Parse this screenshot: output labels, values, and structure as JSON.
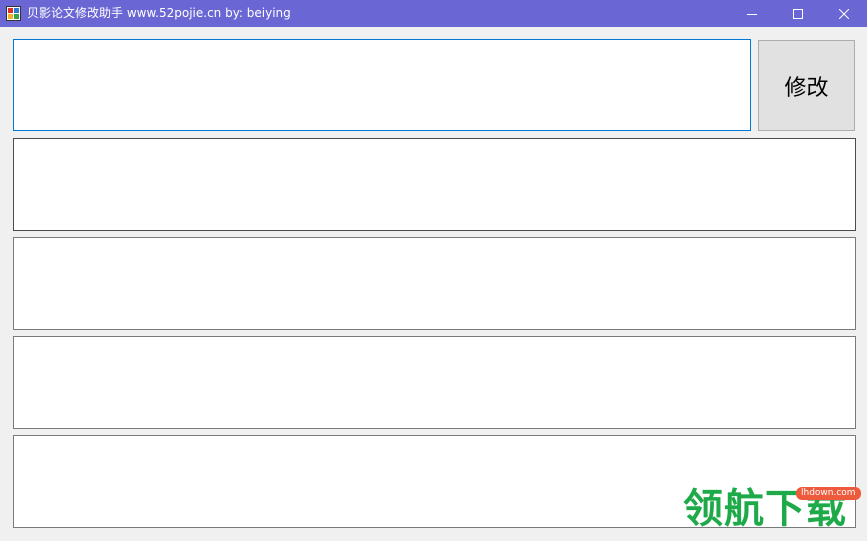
{
  "window": {
    "title": "贝影论文修改助手 www.52pojie.cn by: beiying",
    "title_bar_color": "#6a66d4",
    "controls": {
      "minimize_icon": "minimize-icon",
      "maximize_icon": "maximize-icon",
      "close_icon": "close-icon"
    }
  },
  "main": {
    "input_value": "",
    "modify_button_label": "修改",
    "outputs": [
      {
        "value": ""
      },
      {
        "value": ""
      },
      {
        "value": ""
      },
      {
        "value": ""
      }
    ]
  },
  "watermark": {
    "text": "领航下载",
    "badge": "lhdown.com",
    "color": "#1faa4a",
    "badge_color": "#ee5a3c"
  }
}
